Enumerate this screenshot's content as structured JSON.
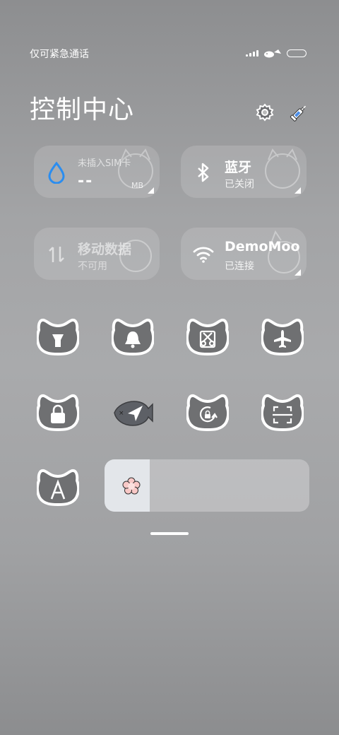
{
  "status_bar": {
    "carrier_text": "仅可紧急通话"
  },
  "header": {
    "title": "控制中心"
  },
  "top_icons": {
    "settings": "gear-icon",
    "edit": "syringe-icon"
  },
  "tiles": {
    "data_usage": {
      "subtitle": "未插入SIM卡",
      "value": "--",
      "unit": "MB",
      "accent": "#2a8df0"
    },
    "bluetooth": {
      "title": "蓝牙",
      "subtitle": "已关闭"
    },
    "mobile_data": {
      "title": "移动数据",
      "subtitle": "不可用"
    },
    "wifi": {
      "title": "DemoMoo",
      "subtitle": "已连接"
    }
  },
  "toggles": [
    {
      "name": "flashlight",
      "icon": "flashlight-icon"
    },
    {
      "name": "sound",
      "icon": "bell-icon"
    },
    {
      "name": "screenshot",
      "icon": "scissors-icon"
    },
    {
      "name": "airplane-mode",
      "icon": "airplane-icon"
    },
    {
      "name": "lock-screen",
      "icon": "lock-icon"
    },
    {
      "name": "location",
      "icon": "location-arrow-icon"
    },
    {
      "name": "auto-rotate",
      "icon": "rotate-lock-icon"
    },
    {
      "name": "scanner",
      "icon": "scan-icon"
    },
    {
      "name": "font-size",
      "icon": "letter-a-icon"
    }
  ],
  "brightness": {
    "level": 0.22,
    "icon": "flower-icon"
  }
}
